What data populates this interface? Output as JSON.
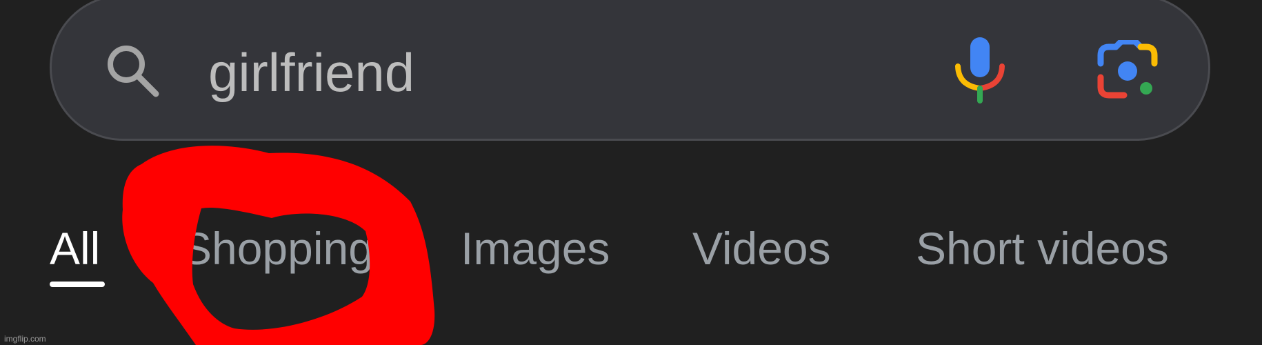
{
  "search": {
    "query": "girlfriend",
    "icons": {
      "search": "search-icon",
      "voice": "mic-icon",
      "lens": "camera-lens-icon"
    }
  },
  "tabs": [
    {
      "label": "All",
      "active": true
    },
    {
      "label": "Shopping",
      "active": false
    },
    {
      "label": "Images",
      "active": false
    },
    {
      "label": "Videos",
      "active": false
    },
    {
      "label": "Short videos",
      "active": false
    }
  ],
  "annotation": {
    "shape": "hand-drawn circle",
    "color": "#ff0000"
  },
  "watermark": "imgflip.com",
  "colors": {
    "background": "#202020",
    "search_bar": "#34353a",
    "tab_inactive": "#9aa0a6",
    "tab_active": "#ffffff",
    "google_blue": "#4285f4",
    "google_red": "#ea4335",
    "google_yellow": "#fbbc04",
    "google_green": "#34a853"
  }
}
